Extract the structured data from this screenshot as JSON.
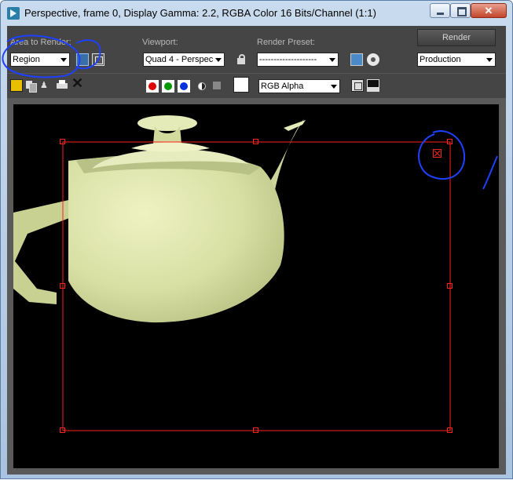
{
  "window": {
    "title": "Perspective, frame 0, Display Gamma: 2.2, RGBA Color 16 Bits/Channel (1:1)",
    "close_glyph": "✕"
  },
  "toolbar": {
    "area_label": "Area to Render:",
    "area_value": "Region",
    "viewport_label": "Viewport:",
    "viewport_value": "Quad 4 - Perspec",
    "preset_label": "Render Preset:",
    "preset_value": "--------------------",
    "render_label": "Render",
    "mode_value": "Production",
    "channel_value": "RGB Alpha"
  },
  "colors": {
    "teapot": "#d8e0a4",
    "region": "#ff2020",
    "annotation": "#1e40ff",
    "swatch_red": "#e00000",
    "swatch_green": "#009a00",
    "swatch_blue": "#0030e0"
  }
}
